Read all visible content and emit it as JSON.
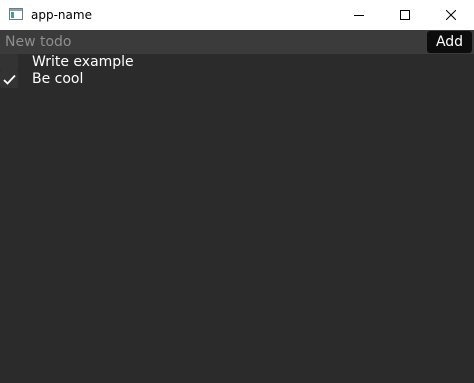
{
  "window": {
    "title": "app-name"
  },
  "new_todo": {
    "placeholder": "New todo",
    "value": ""
  },
  "add_button": {
    "label": "Add"
  },
  "todos": [
    {
      "label": "Write example",
      "checked": false
    },
    {
      "label": "Be cool",
      "checked": true
    }
  ],
  "colors": {
    "background": "#2b2b2b",
    "titlebar": "#ffffff",
    "input_background": "#3b3b3b",
    "button_background": "#0c0c0c",
    "text": "#ffffff",
    "placeholder": "#8e8e8e"
  },
  "icons": {
    "app": "app-window-icon",
    "minimize": "minimize-icon",
    "maximize": "maximize-icon",
    "close": "close-icon",
    "check": "checkmark-icon"
  }
}
